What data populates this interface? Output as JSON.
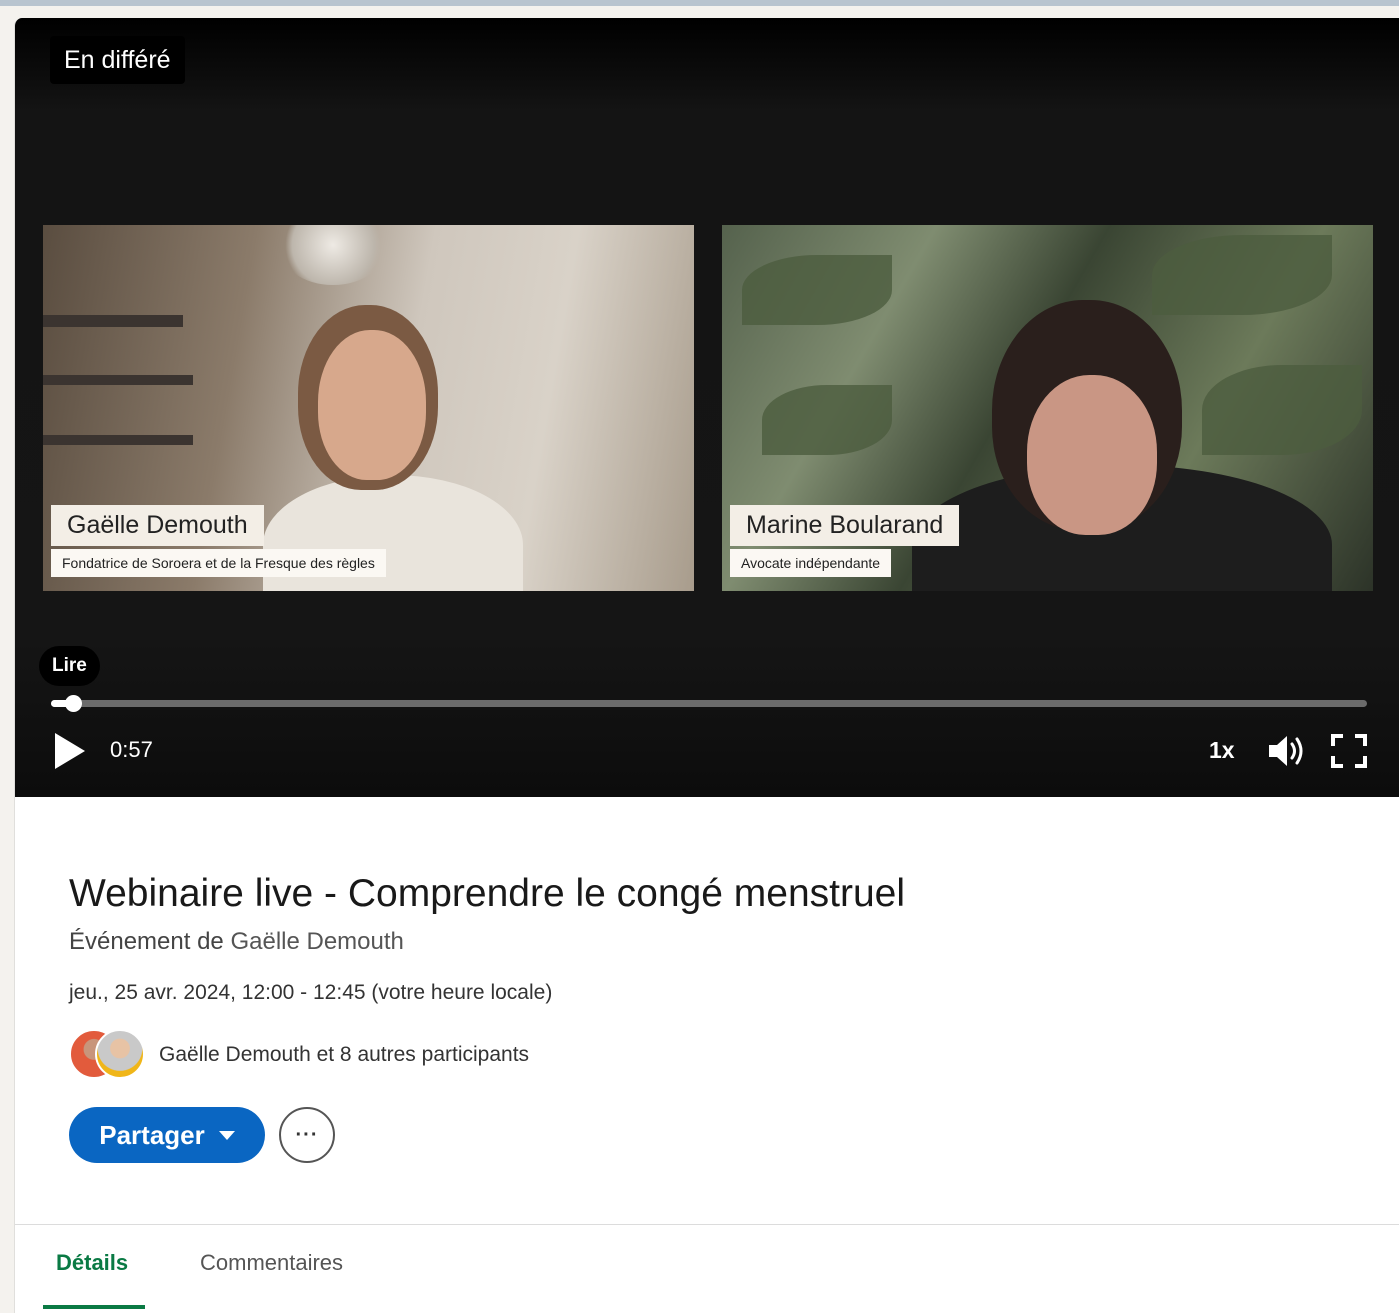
{
  "player": {
    "status_badge": "En différé",
    "speakers": [
      {
        "name": "Gaëlle Demouth",
        "role": "Fondatrice de Soroera et de la Fresque des règles"
      },
      {
        "name": "Marine Boularand",
        "role": "Avocate indépendante"
      }
    ],
    "play_tooltip": "Lire",
    "current_time": "0:57",
    "progress_fraction": 0.017,
    "speed": "1x",
    "icons": {
      "play": "play-icon",
      "volume": "volume-icon",
      "fullscreen": "fullscreen-icon"
    }
  },
  "event": {
    "title": "Webinaire live - Comprendre le congé menstruel",
    "organizer_prefix": "Événement de",
    "organizer_name": "Gaëlle Demouth",
    "datetime": "jeu., 25 avr. 2024, 12:00 - 12:45 (votre heure locale)",
    "participants": "Gaëlle Demouth et 8 autres participants",
    "share_label": "Partager",
    "more_label": "···"
  },
  "tabs": [
    {
      "label": "Détails",
      "active": true
    },
    {
      "label": "Commentaires",
      "active": false
    }
  ],
  "colors": {
    "accent_blue": "#0a66c2",
    "active_tab_green": "#0a7a44"
  }
}
